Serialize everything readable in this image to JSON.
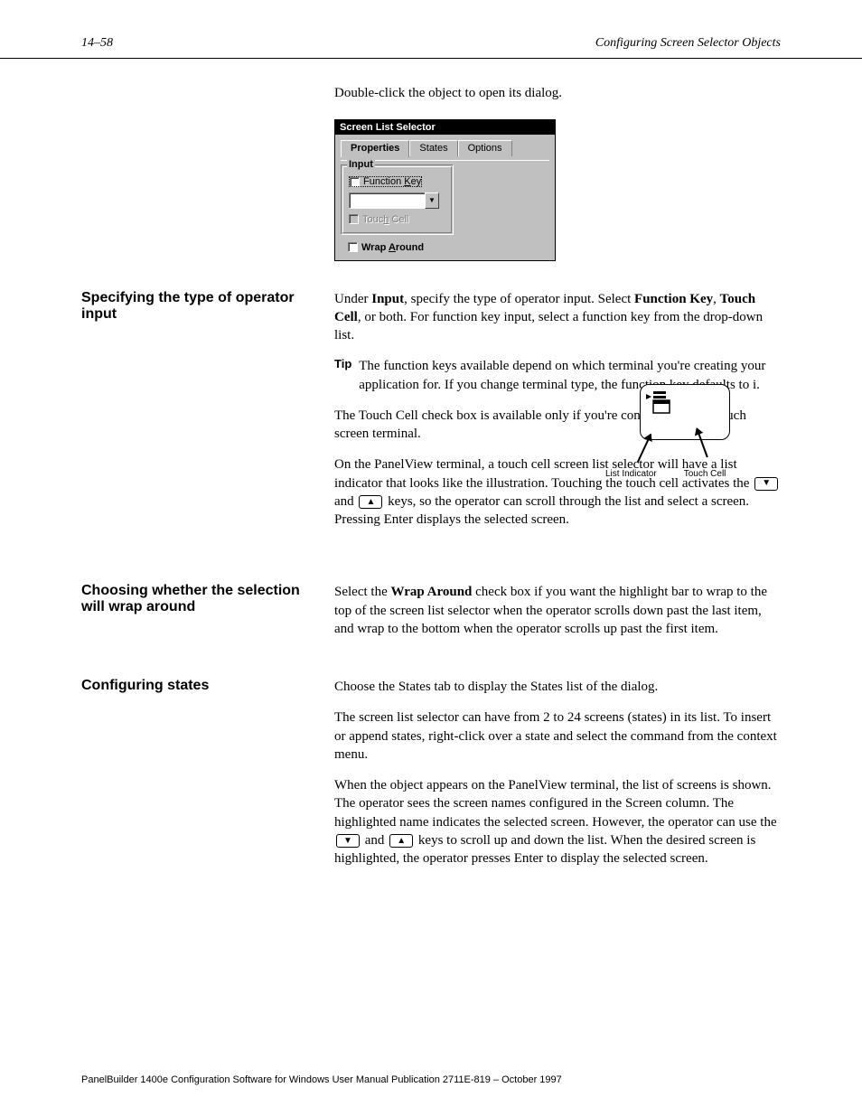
{
  "header": {
    "page_number": "14–58",
    "page_title": "Configuring Screen Selector Objects"
  },
  "intro": "Double-click the object to open its dialog.",
  "dialog": {
    "title": "Screen List Selector",
    "tabs": {
      "properties": "Properties",
      "states": "States",
      "options": "Options"
    },
    "groupbox_label": "Input",
    "function_key_label": "Function Key",
    "function_key_access": "K",
    "touch_cell_label": "Touch Cell",
    "touch_cell_access": "h",
    "wrap_around_label": "Wrap Around",
    "wrap_around_access": "A"
  },
  "operator_input": {
    "heading": "Specifying the type of operator input",
    "para1_pre": "Under ",
    "para1_b1": "Input",
    "para1_mid": ", specify the type of operator input. Select  ",
    "para1_b2": "Function Key",
    "para1_mid2": ", ",
    "para1_b3": "Touch Cell",
    "para1_post": ", or both. For function key input, select a function key from the drop-down list.",
    "tip_label": "Tip",
    "tip_body": "The function keys available depend on which terminal you're creating your application for. If you change terminal type, the function key defaults to i.",
    "para3": "The Touch Cell check box is available only if you're configuring for a touch screen terminal.",
    "para4_pre": "On the PanelView terminal, a touch cell screen list selector will have a list indicator that looks like the illustration. Touching the touch cell activates the ",
    "para4_mid": " and ",
    "para4_post": " keys, so the operator can scroll through the list and select a screen. Pressing Enter displays the selected screen.",
    "illus": {
      "label1": "List Indicator",
      "label2": "Touch Cell"
    }
  },
  "wrap_around": {
    "heading": "Choosing whether the selection will wrap around",
    "para_pre": "Select the ",
    "para_b": "Wrap Around",
    "para_post": " check box if you want the highlight bar to wrap to the top of the screen list selector when the operator scrolls down past the last item, and wrap to the bottom when the operator scrolls up past the first item."
  },
  "states": {
    "heading": "Configuring states",
    "para1": "Choose the States tab to display the States list of the dialog.",
    "para2": "The screen list selector can have from 2 to 24 screens (states) in its list. To insert or append states, right-click over a state and select the command from the context menu.",
    "para3_pre": "When the object appears on the PanelView terminal, the list of screens is shown. The operator sees the screen names configured in the Screen column. The highlighted name indicates the selected screen. However, the operator can use the ",
    "para3_mid": " and ",
    "para3_post": " keys to scroll up and down the list. When the desired screen is highlighted, the operator presses Enter to display the selected screen."
  },
  "footer": "PanelBuilder 1400e Configuration Software for Windows User Manual \tPublication 2711E-819 – October 1997"
}
